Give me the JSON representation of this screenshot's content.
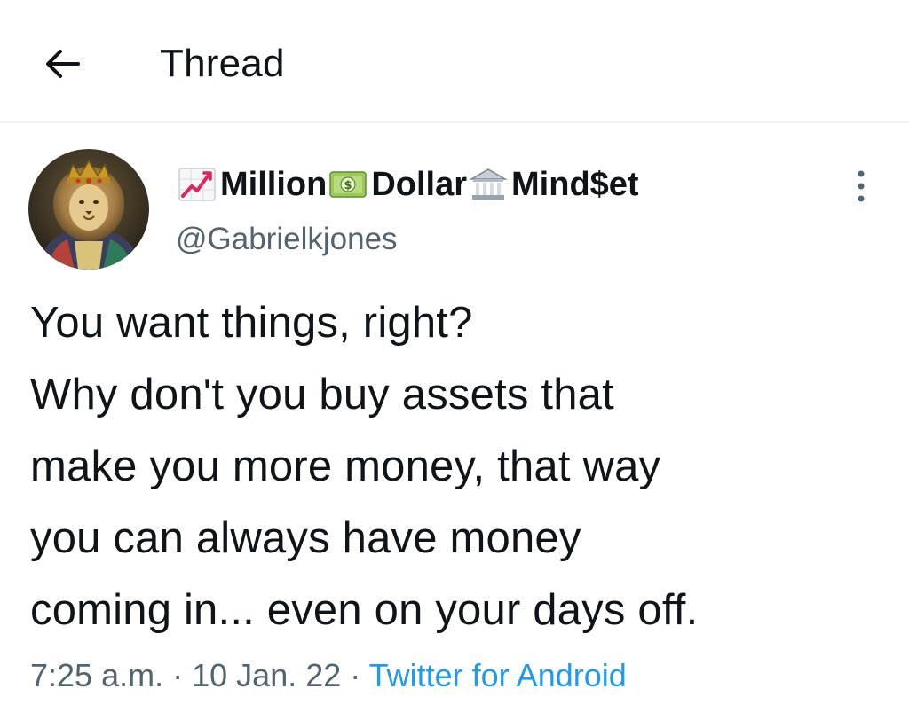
{
  "header": {
    "title": "Thread"
  },
  "tweet": {
    "author": {
      "name_part1": "Million",
      "name_part2": "Dollar",
      "name_part3": "Mind$et",
      "handle": "@Gabrielkjones"
    },
    "text_lines": [
      "You want things, right?",
      "Why don't you buy assets that",
      "make you more money, that way",
      "you can always have money",
      "coming in... even on your days off."
    ],
    "time": "7:25 a.m.",
    "date": "10 Jan. 22",
    "separator": "·",
    "source": "Twitter for Android"
  },
  "colors": {
    "text": "#0f1419",
    "secondary": "#536471",
    "link": "#1d9bf0",
    "divider": "#eff3f4"
  },
  "icons": {
    "back": "arrow-left-icon",
    "more": "more-vertical-icon",
    "name_emoji_1": "chart-increasing-icon",
    "name_emoji_2": "dollar-banknote-icon",
    "name_emoji_3": "bank-icon"
  }
}
